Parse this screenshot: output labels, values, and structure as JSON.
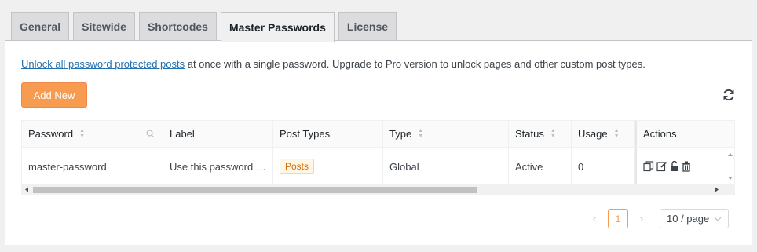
{
  "tabs": [
    {
      "label": "General",
      "active": false
    },
    {
      "label": "Sitewide",
      "active": false
    },
    {
      "label": "Shortcodes",
      "active": false
    },
    {
      "label": "Master Passwords",
      "active": true
    },
    {
      "label": "License",
      "active": false
    }
  ],
  "intro": {
    "link_text": "Unlock all password protected posts",
    "rest_text": " at once with a single password. Upgrade to Pro version to unlock pages and other custom post types."
  },
  "toolbar": {
    "add_new_label": "Add New",
    "refresh_icon": "refresh-icon"
  },
  "table": {
    "columns": [
      "Password",
      "Label",
      "Post Types",
      "Type",
      "Status",
      "Usage",
      "Actions"
    ],
    "rows": [
      {
        "password": "master-password",
        "label": "Use this password …",
        "post_types": "Posts",
        "type": "Global",
        "status": "Active",
        "usage": "0"
      }
    ]
  },
  "pagination": {
    "current_page": "1",
    "page_size": "10 / page"
  },
  "colors": {
    "accent": "#f69b50",
    "link": "#2271b1",
    "active_status": "#389e0d"
  }
}
